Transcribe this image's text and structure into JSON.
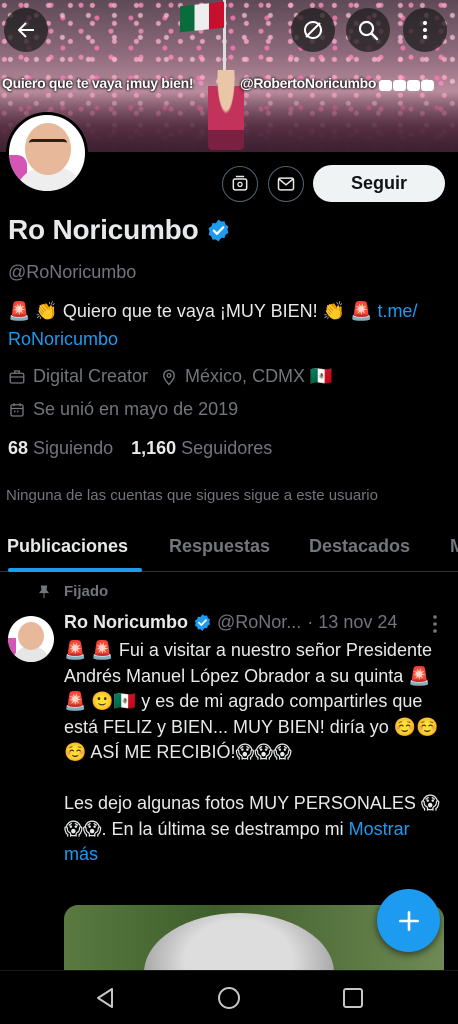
{
  "banner": {
    "text_left": "Quiero que te vaya ¡muy bien!",
    "text_right": "@RobertoNoricumbo"
  },
  "profile": {
    "name": "Ro Noricumbo",
    "handle": "@RoNoricumbo",
    "bio_prefix": "🚨 👏 Quiero que te vaya ¡MUY BIEN! 👏 🚨 ",
    "bio_link_part1": "t.me/",
    "bio_link_part2": "RoNoricumbo",
    "category": "Digital Creator",
    "location": "México, CDMX 🇲🇽",
    "joined": "Se unió en mayo de 2019",
    "following_count": "68",
    "following_label": "Siguiendo",
    "followers_count": "1,160",
    "followers_label": "Seguidores",
    "follow_notice": "Ninguna de las cuentas que sigues sigue a este usuario"
  },
  "actions": {
    "follow_label": "Seguir"
  },
  "tabs": [
    {
      "label": "Publicaciones",
      "active": true
    },
    {
      "label": "Respuestas",
      "active": false
    },
    {
      "label": "Destacados",
      "active": false
    },
    {
      "label": "M",
      "active": false
    }
  ],
  "post": {
    "pinned_label": "Fijado",
    "author_name": "Ro Noricumbo",
    "author_handle": "@RoNor...",
    "date": "· 13 nov 24",
    "text_p1": "🚨 🚨 Fui a visitar a nuestro señor Presidente Andrés Manuel López Obrador a su quinta 🚨 🚨 🙂🇲🇽 y es de mi agrado compartirles que está FELIZ y BIEN... MUY BIEN! diría yo ☺️☺️☺️ ASÍ ME RECIBIÓ!😱😱😱",
    "text_p2": "Les dejo algunas fotos MUY PERSONALES 😱😱😱. En la última se destrampo mi ",
    "show_more": "Mostrar más"
  },
  "colors": {
    "accent": "#1d9bf0",
    "background": "#000000",
    "text_primary": "#e7e9ea",
    "text_secondary": "#71767b"
  },
  "icons": [
    "back-arrow-icon",
    "hide-icon",
    "search-icon",
    "more-vertical-icon",
    "subscription-icon",
    "mail-icon",
    "briefcase-icon",
    "location-pin-icon",
    "calendar-icon",
    "pin-icon",
    "verified-badge-icon",
    "plus-icon",
    "nav-back-icon",
    "nav-home-icon",
    "nav-recents-icon"
  ]
}
